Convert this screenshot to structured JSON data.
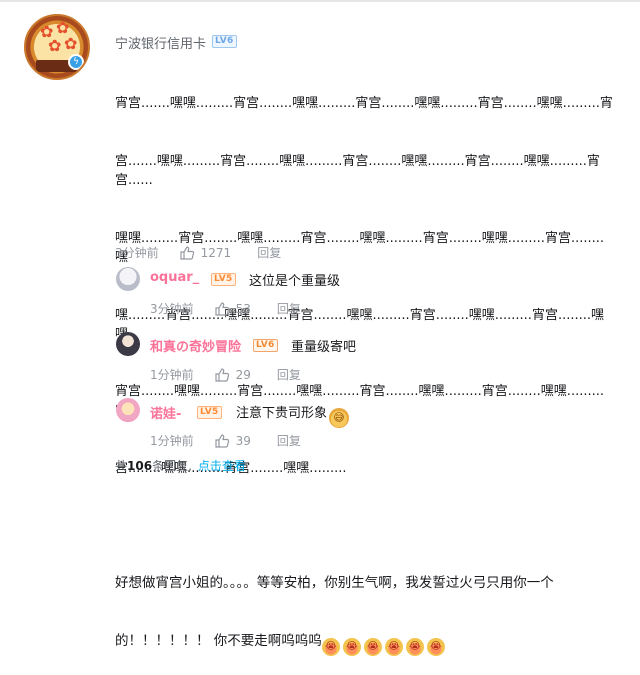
{
  "main_comment": {
    "username": "宁波银行信用卡",
    "level": "LV6",
    "content_lines": [
      "宵宫.......嘿嘿.........宵宫........嘿嘿.........宵宫........嘿嘿.........宵宫........嘿嘿.........宵",
      "宫.......嘿嘿.........宵宫........嘿嘿.........宵宫........嘿嘿.........宵宫........嘿嘿.........宵宫......",
      "嘿嘿.........宵宫........嘿嘿.........宵宫........嘿嘿.........宵宫........嘿嘿.........宵宫........嘿",
      "嘿.........宵宫........嘿嘿.........宵宫........嘿嘿.........宵宫........嘿嘿.........宵宫........嘿嘿",
      "宵宫........嘿嘿.........宵宫........嘿嘿.........宵宫........嘿嘿.........宵宫........嘿嘿.........宵",
      "宫........嘿嘿.........宵宫........嘿嘿........."
    ],
    "content_tail_line1": "好想做宵宫小姐的。。。。等等安柏，你别生气啊，我发誓过火弓只用你一个",
    "content_tail_line2": "的！！！！！！ 你不要走啊呜呜呜",
    "time": "3分钟前",
    "likes": "1271",
    "reply_label": "回复"
  },
  "replies": [
    {
      "username": "oquar_",
      "level": "LV5",
      "content": "这位是个重量级",
      "time": "3分钟前",
      "likes": "53",
      "reply_label": "回复"
    },
    {
      "username": "和真の奇妙冒险",
      "level": "LV6",
      "content": "重量级寄吧",
      "time": "1分钟前",
      "likes": "29",
      "reply_label": "回复"
    },
    {
      "username": "诺娃-",
      "level": "LV5",
      "content": "注意下贵司形象",
      "time": "1分钟前",
      "likes": "39",
      "reply_label": "回复"
    }
  ],
  "footer": {
    "prefix": "共",
    "count": "106",
    "suffix": "条回复,",
    "link": "点击查看"
  },
  "colors": {
    "username_pink": "#fb7299",
    "link_blue": "#00aeec",
    "meta_gray": "#9499a0"
  },
  "icons": {
    "like": "thumbs-up-icon",
    "emote": "crying-face-emote",
    "sticker": "sweat-face-sticker"
  }
}
